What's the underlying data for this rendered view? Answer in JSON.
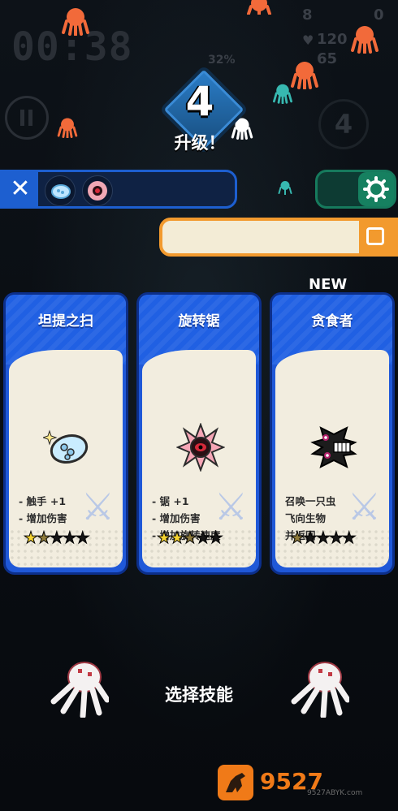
{
  "hud": {
    "timer": "00:38",
    "percent": "32%",
    "top_right_a": "8",
    "top_right_b": "0",
    "hp": "120",
    "bottom_stat": "65",
    "side_badge": "4"
  },
  "level": {
    "number": "4",
    "label": "升级！"
  },
  "skillbar": {
    "close_label": "✕"
  },
  "new_tag": "NEW",
  "cards": [
    {
      "title": "坦提之扫",
      "desc": "- 触手 +1\n- 增加伤害",
      "stars": [
        "gold",
        "bronze",
        "empty",
        "empty",
        "empty"
      ]
    },
    {
      "title": "旋转锯",
      "desc": "- 锯 +1\n- 增加伤害\n- 增加旋转速度",
      "stars": [
        "gold",
        "gold",
        "bronze",
        "empty",
        "empty"
      ]
    },
    {
      "title": "贪食者",
      "desc": "召唤一只虫\n飞向生物\n并返回",
      "stars": [
        "bronze",
        "empty",
        "empty",
        "empty",
        "empty"
      ]
    }
  ],
  "bottom": {
    "label": "选择技能"
  },
  "watermark": {
    "text": "9527",
    "sub": "9527ABYK.com"
  },
  "colors": {
    "card_blue": "#1f58d8",
    "orange": "#f29a2e",
    "teal": "#168060"
  }
}
